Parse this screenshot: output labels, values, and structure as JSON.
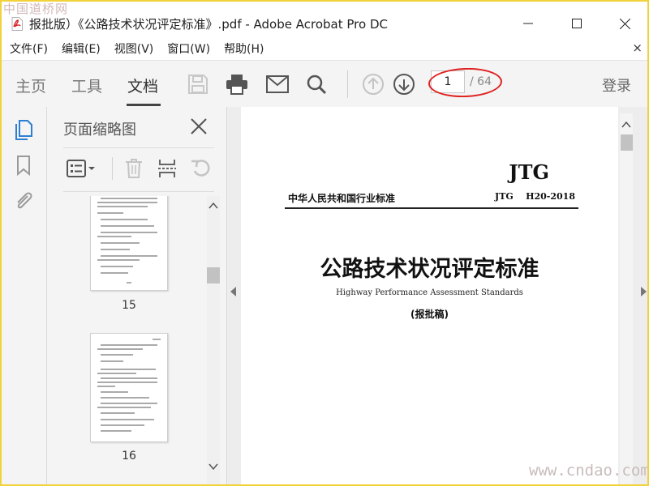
{
  "watermark_top": "中国道桥网",
  "window": {
    "title": "报批版）《公路技术状况评定标准》.pdf - Adobe Acrobat Pro DC"
  },
  "menu": {
    "items": [
      "文件(F)",
      "编辑(E)",
      "视图(V)",
      "窗口(W)",
      "帮助(H)"
    ],
    "close_glyph": "×"
  },
  "toolbar": {
    "tabs": [
      {
        "label": "主页",
        "active": false
      },
      {
        "label": "工具",
        "active": false
      },
      {
        "label": "文档",
        "active": true
      }
    ],
    "icons": [
      "save-icon",
      "print-icon",
      "mail-icon",
      "search-icon",
      "page-up-icon",
      "page-down-icon"
    ],
    "current_page": "1",
    "total_pages": "/ 64",
    "login_label": "登录"
  },
  "thumbnail_panel": {
    "title": "页面缩略图",
    "tools": [
      "page-options-icon",
      "delete-icon",
      "extract-icon",
      "undo-icon"
    ],
    "pages": [
      {
        "number": "15"
      },
      {
        "number": "16"
      }
    ]
  },
  "document": {
    "series": "JTG",
    "issuer": "中华人民共和国行业标准",
    "code": "JTG    H20-2018",
    "title": "公路技术状况评定标准",
    "subtitle": "Highway Performance Assessment Standards",
    "note": "(报批稿)"
  },
  "watermark_bottom": "www.cndao.com",
  "colors": {
    "accent": "#2d7fd3",
    "annotation": "#e02020",
    "pdf_red": "#d8232a",
    "frame": "#f2d23a"
  }
}
